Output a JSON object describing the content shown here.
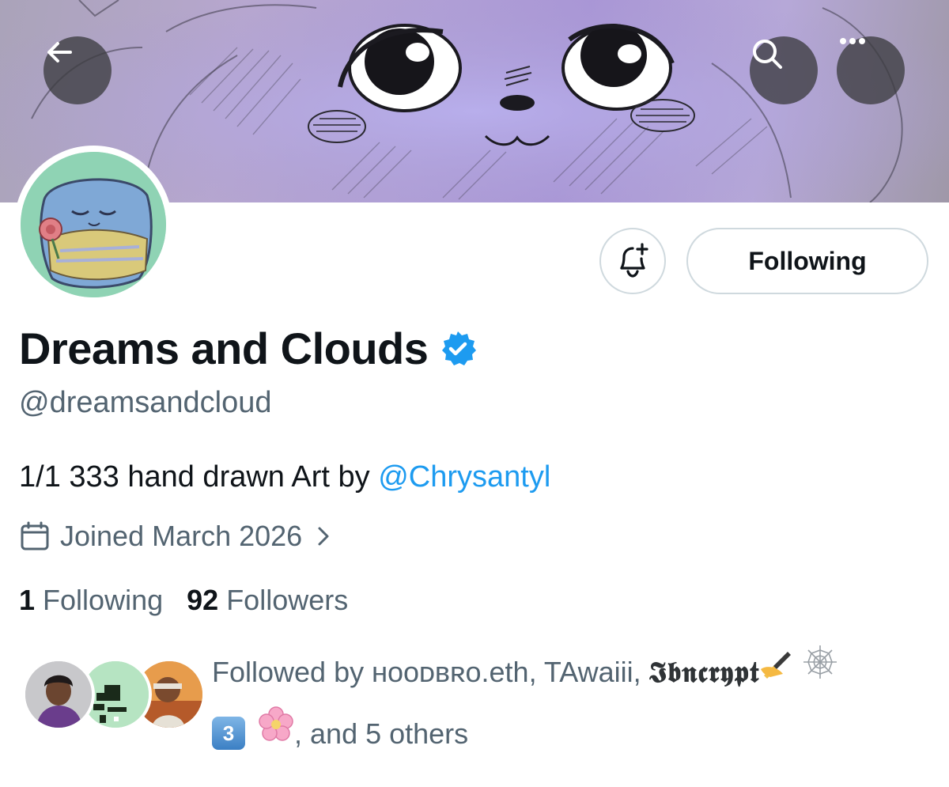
{
  "header": {
    "back_icon": "arrow-left-icon",
    "search_icon": "search-icon",
    "more_icon": "more-horizontal-icon"
  },
  "profile": {
    "display_name": "Dreams and Clouds",
    "handle": "@dreamsandcloud",
    "bio_text": "1/1 333 hand drawn Art by ",
    "bio_mention": "@Chrysantyl",
    "joined": "Joined March 2026",
    "verified_color": "#1d9bf0"
  },
  "actions": {
    "notify_icon": "bell-plus-icon",
    "following_label": "Following"
  },
  "stats": {
    "following_count": "1",
    "following_label": "Following",
    "followers_count": "92",
    "followers_label": "Followers"
  },
  "followed_by": {
    "prefix": "Followed by ",
    "names": "ʜᴏᴏᴅʙʀᴏ.eth, TAwaiii, ",
    "styled_name": "𝕴𝖇𝖓𝖈𝖗𝖞𝖕𝖙",
    "keycap": "3",
    "suffix": ", and 5 others"
  },
  "colors": {
    "text_primary": "#0f1419",
    "text_secondary": "#536471",
    "link": "#1d9bf0",
    "border": "#cfd9de"
  }
}
